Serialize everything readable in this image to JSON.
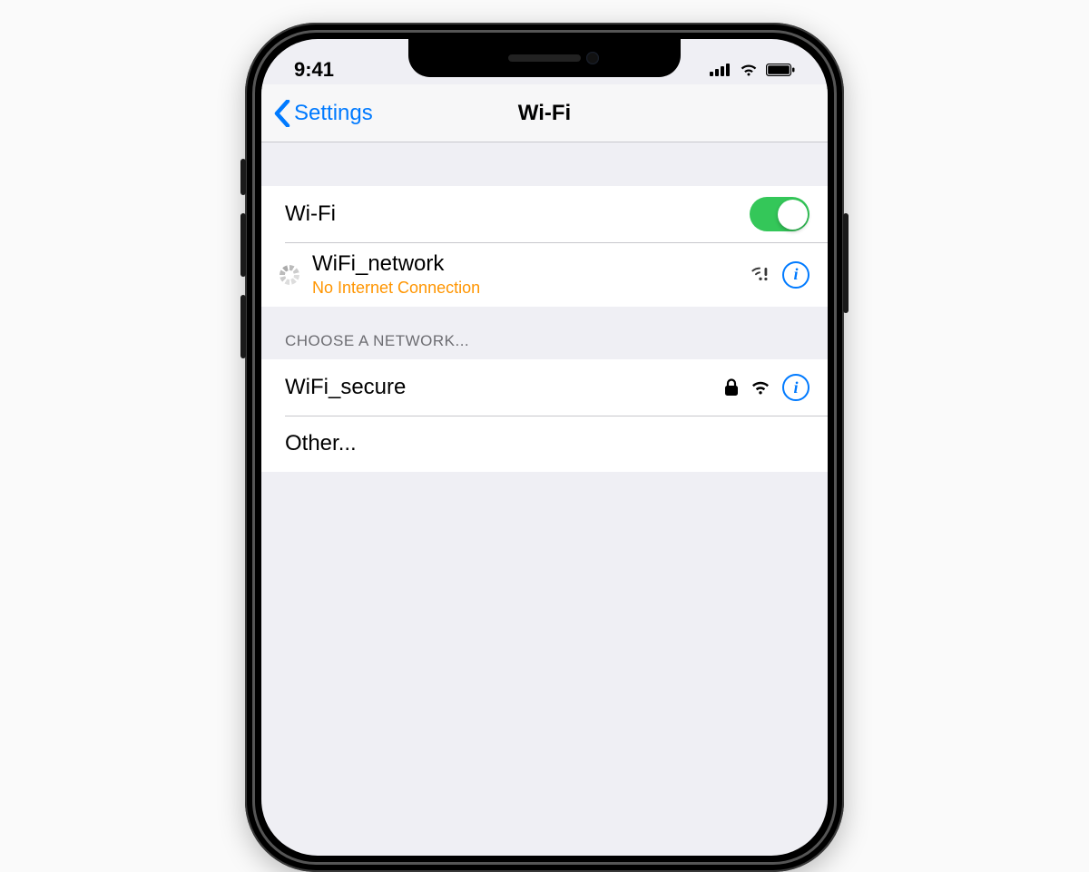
{
  "statusbar": {
    "time": "9:41"
  },
  "nav": {
    "back_label": "Settings",
    "title": "Wi-Fi"
  },
  "wifi_row": {
    "label": "Wi-Fi",
    "enabled": true
  },
  "current_network": {
    "name": "WiFi_network",
    "status": "No Internet Connection"
  },
  "networks_header": "Choose a Network...",
  "networks": [
    {
      "name": "WiFi_secure",
      "secure": true
    }
  ],
  "other_label": "Other..."
}
